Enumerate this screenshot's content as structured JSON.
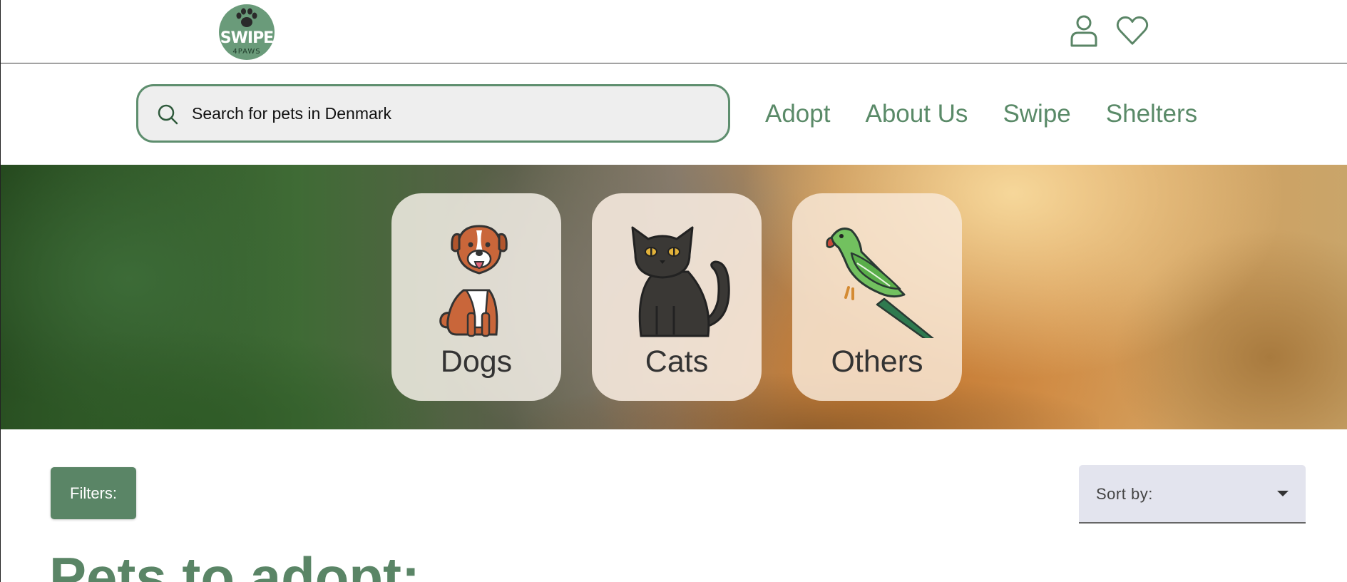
{
  "header": {
    "logo_title": "SWIPE",
    "logo_sub": "4PAWS",
    "icons": [
      "user-icon",
      "heart-icon"
    ]
  },
  "search": {
    "placeholder": "Search for pets in Denmark",
    "value": ""
  },
  "nav": {
    "links": [
      "Adopt",
      "About Us",
      "Swipe",
      "Shelters"
    ]
  },
  "categories": [
    {
      "label": "Dogs",
      "icon": "dog-icon"
    },
    {
      "label": "Cats",
      "icon": "cat-icon"
    },
    {
      "label": "Others",
      "icon": "parrot-icon"
    }
  ],
  "controls": {
    "filters_label": "Filters:",
    "sort_label": "Sort by:"
  },
  "main": {
    "title": "Pets to adopt:"
  },
  "colors": {
    "accent": "#5a8566",
    "logo_bg": "#6a9b7a",
    "search_bg": "#eeeeee",
    "sort_bg": "#e3e4ee"
  }
}
